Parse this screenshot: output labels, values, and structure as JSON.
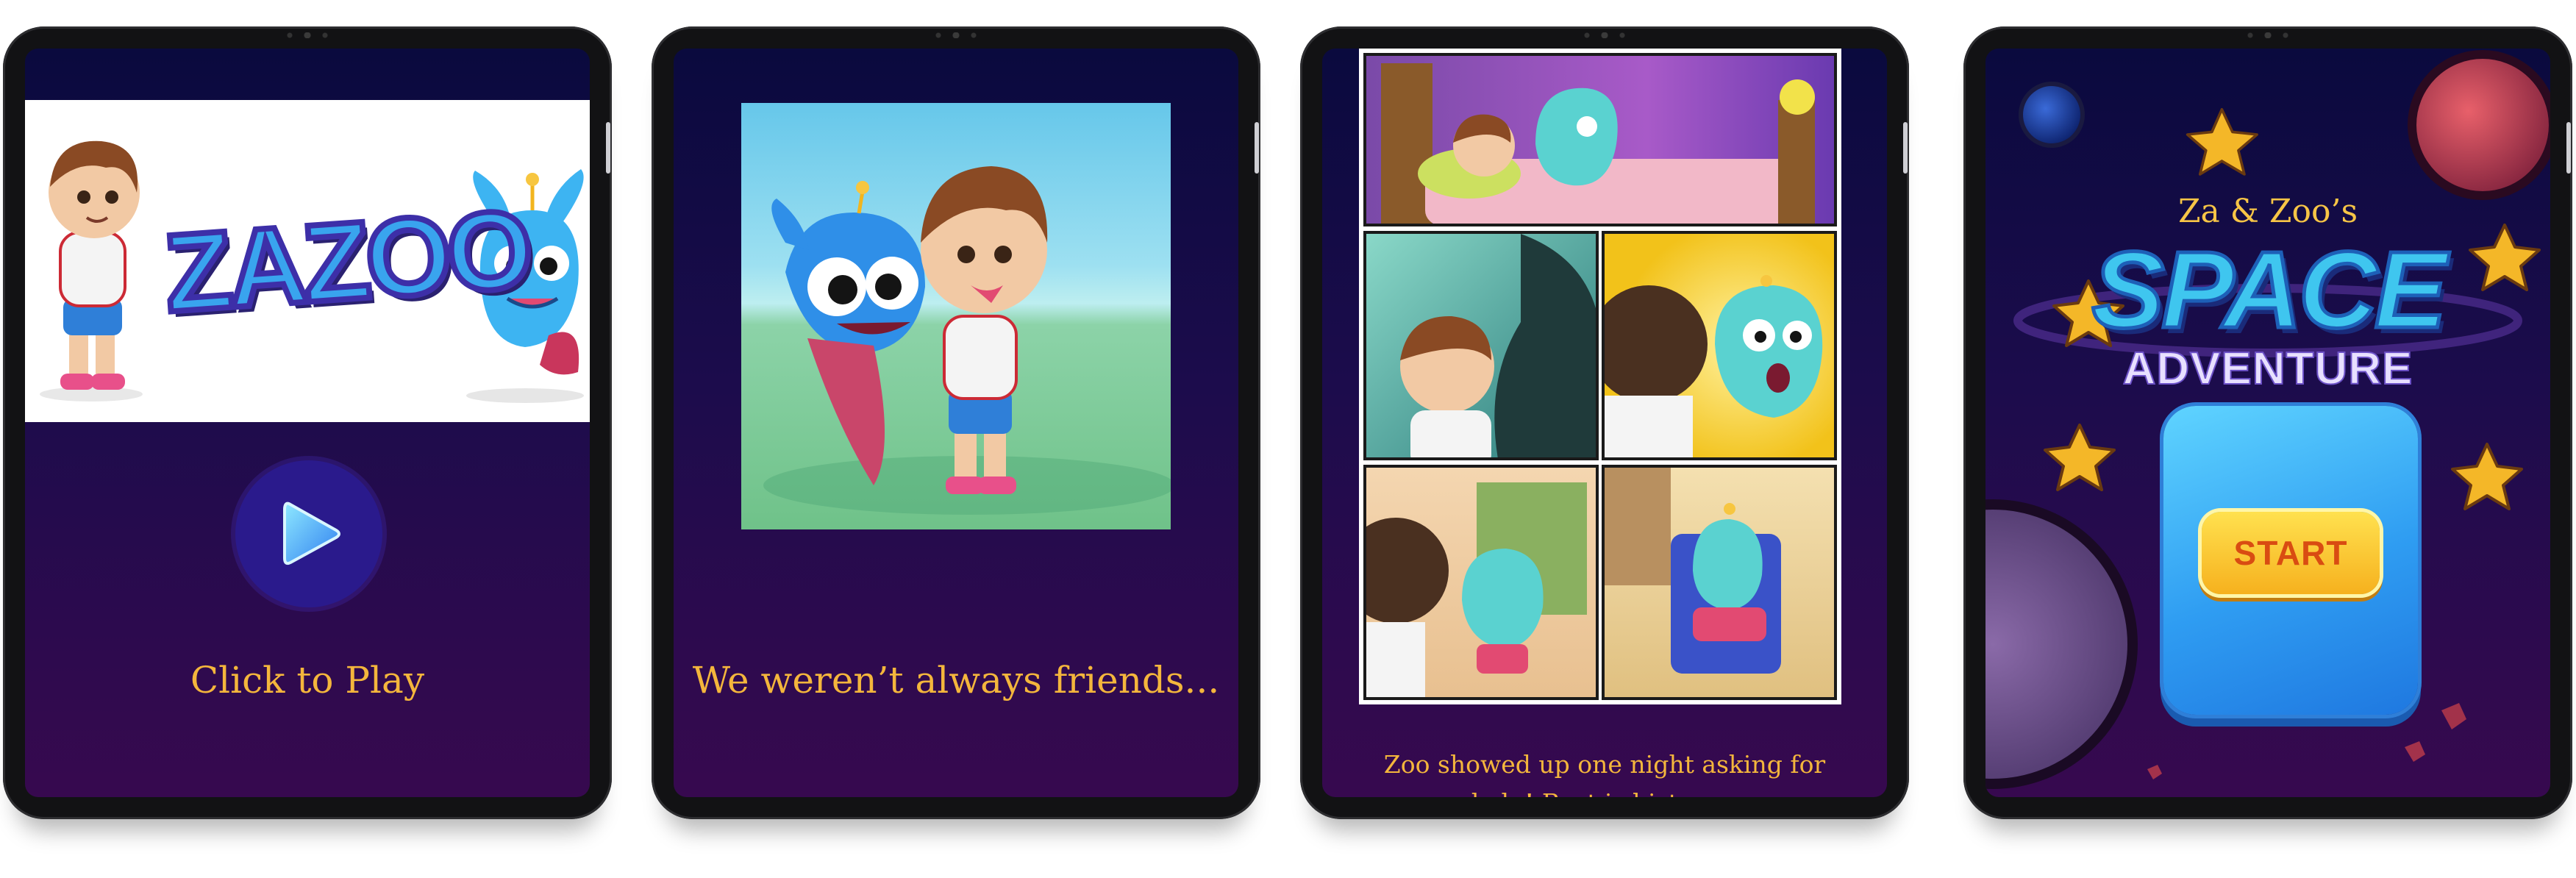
{
  "screens": [
    {
      "logo": "ZAZOO",
      "play_icon": "play-icon",
      "caption": "Click to Play"
    },
    {
      "caption": "We weren’t always friends..."
    },
    {
      "caption": "Zoo showed up one night asking for help! Rest is history..."
    },
    {
      "title_small": "Za & Zoo’s",
      "title_big": "SPACE",
      "title_sub": "ADVENTURE",
      "start_label": "START"
    }
  ],
  "colors": {
    "screen_top": "#0a0a3e",
    "screen_bottom": "#37094f",
    "caption": "#f4b63c",
    "play_button": "#2a1a8c",
    "start_button": "#f6b11e"
  }
}
